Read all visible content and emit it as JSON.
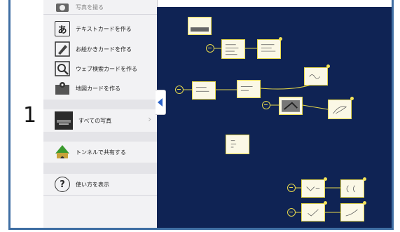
{
  "menu": {
    "items": [
      {
        "label": "写真を撮る",
        "icon": "camera-icon"
      },
      {
        "label": "テキストカードを作る",
        "icon": "text-card-icon",
        "glyph": "あ"
      },
      {
        "label": "お絵かきカードを作る",
        "icon": "pencil-icon"
      },
      {
        "label": "ウェブ検索カードを作る",
        "icon": "magnifier-icon"
      },
      {
        "label": "地図カードを作る",
        "icon": "map-icon"
      },
      {
        "label": "すべての写真",
        "icon": "photo-thumbnail-icon"
      },
      {
        "label": "トンネルで共有する",
        "icon": "tunnel-share-icon"
      },
      {
        "label": "使い方を表示",
        "icon": "help-icon",
        "glyph": "?"
      }
    ],
    "chevron": "›"
  },
  "annotation": {
    "numeral": "1"
  },
  "colors": {
    "canvas": "#0f2354",
    "card_border": "#e7d94a",
    "tab_arrow": "#2a62c9",
    "frame": "#3f6ea3"
  }
}
